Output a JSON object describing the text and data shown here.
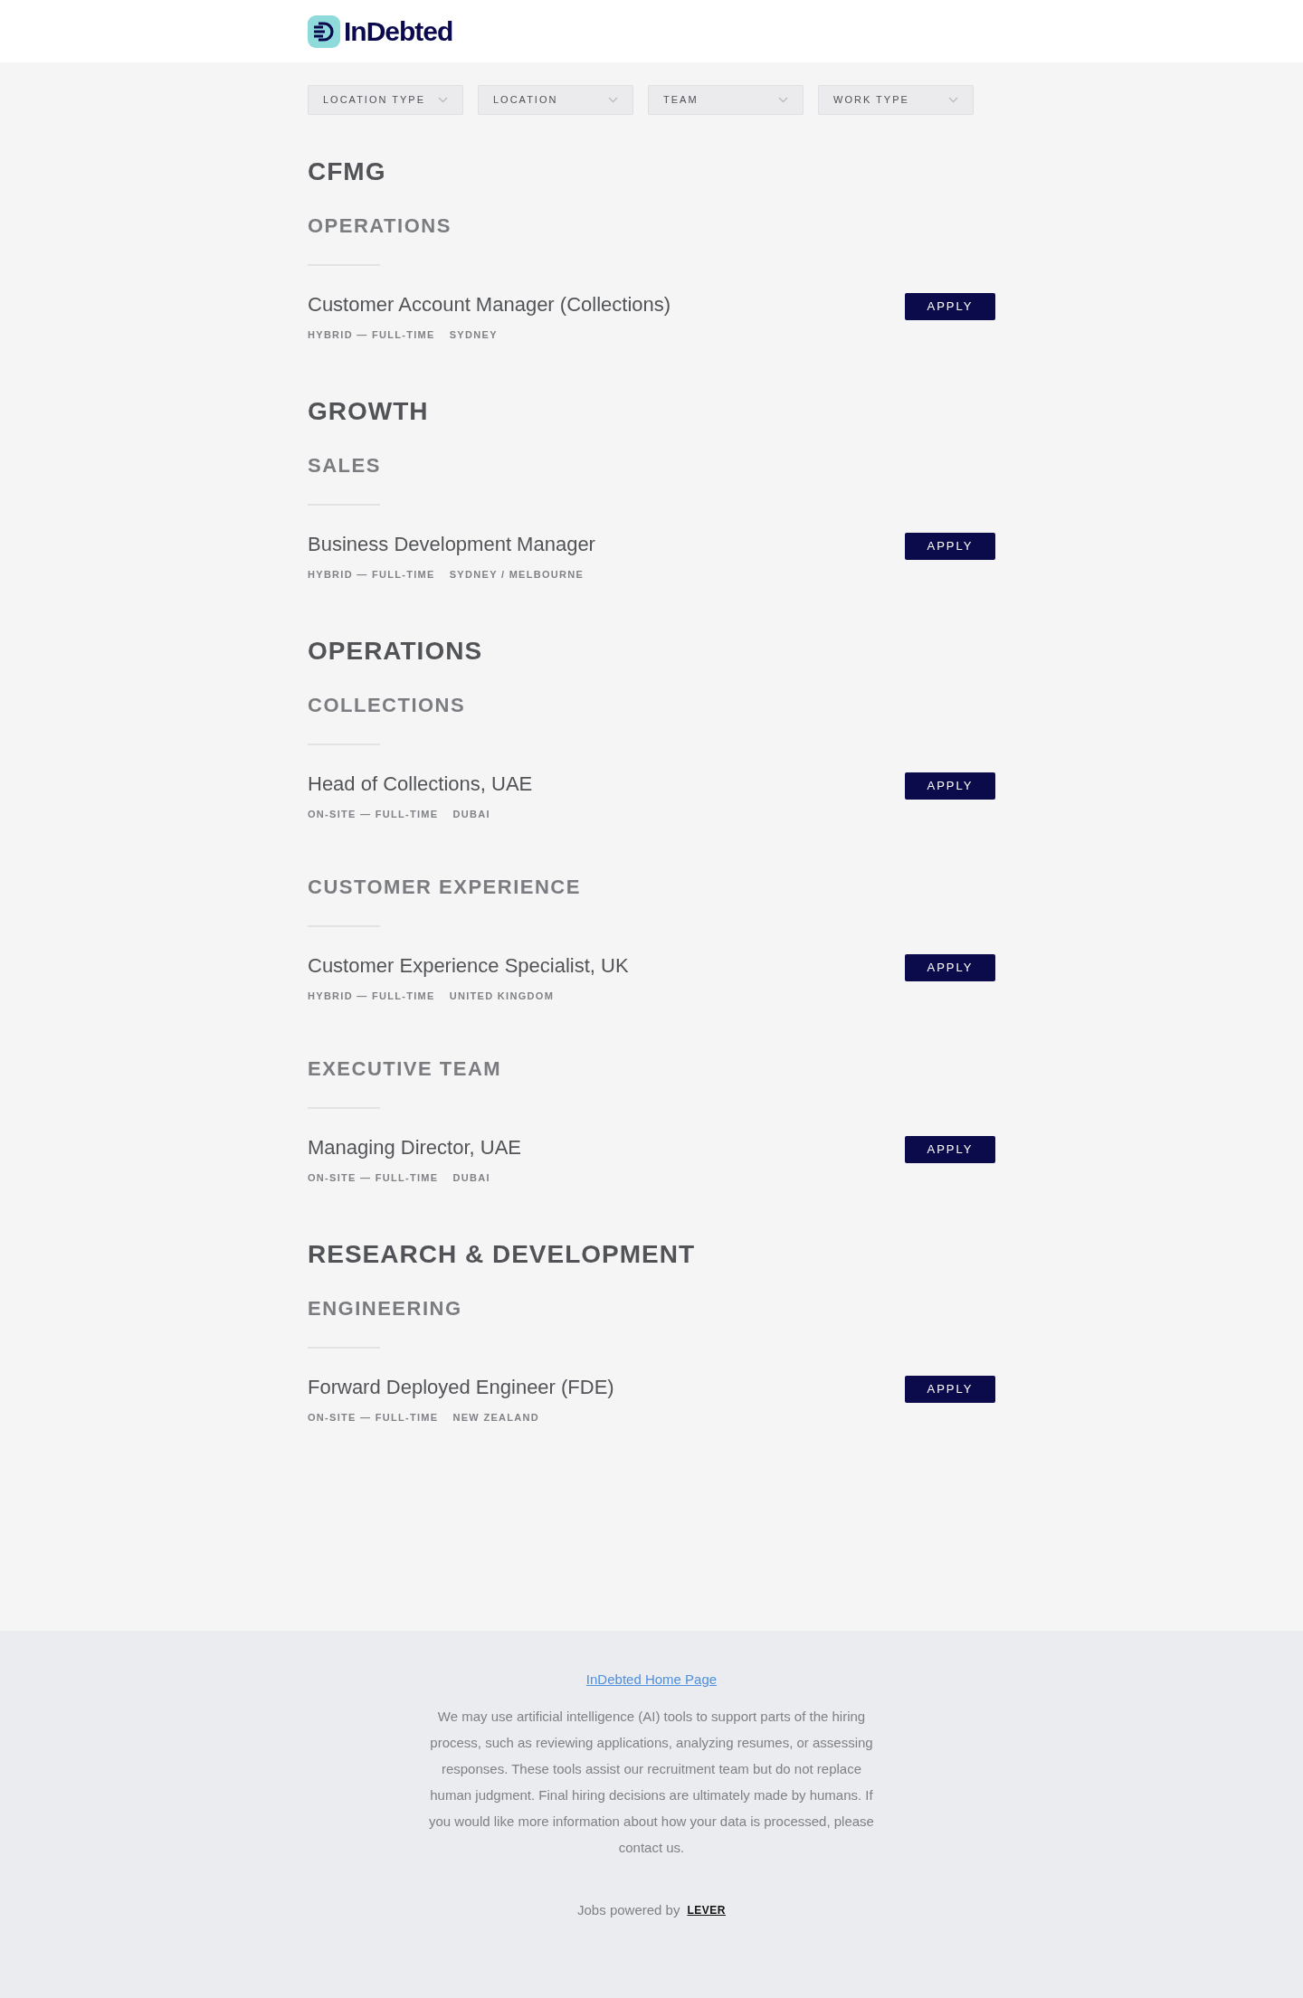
{
  "header": {
    "logo_text": "InDebted"
  },
  "filters": [
    {
      "label": "LOCATION TYPE"
    },
    {
      "label": "LOCATION"
    },
    {
      "label": "TEAM"
    },
    {
      "label": "WORK TYPE"
    }
  ],
  "departments": [
    {
      "name": "CFMG",
      "teams": [
        {
          "name": "OPERATIONS",
          "postings": [
            {
              "title": "Customer Account Manager (Collections)",
              "meta": "HYBRID — FULL-TIME",
              "location": "SYDNEY",
              "button": "APPLY"
            }
          ]
        }
      ]
    },
    {
      "name": "GROWTH",
      "teams": [
        {
          "name": "SALES",
          "postings": [
            {
              "title": "Business Development Manager",
              "meta": "HYBRID — FULL-TIME",
              "location": "SYDNEY / MELBOURNE",
              "button": "APPLY"
            }
          ]
        }
      ]
    },
    {
      "name": "OPERATIONS",
      "teams": [
        {
          "name": "COLLECTIONS",
          "postings": [
            {
              "title": "Head of Collections, UAE",
              "meta": "ON-SITE — FULL-TIME",
              "location": "DUBAI",
              "button": "APPLY"
            }
          ]
        },
        {
          "name": "CUSTOMER EXPERIENCE",
          "postings": [
            {
              "title": "Customer Experience Specialist, UK",
              "meta": "HYBRID — FULL-TIME",
              "location": "UNITED KINGDOM",
              "button": "APPLY"
            }
          ]
        },
        {
          "name": "EXECUTIVE TEAM",
          "postings": [
            {
              "title": "Managing Director, UAE",
              "meta": "ON-SITE — FULL-TIME",
              "location": "DUBAI",
              "button": "APPLY"
            }
          ]
        }
      ]
    },
    {
      "name": "RESEARCH & DEVELOPMENT",
      "teams": [
        {
          "name": "ENGINEERING",
          "postings": [
            {
              "title": "Forward Deployed Engineer (FDE)",
              "meta": "ON-SITE — FULL-TIME",
              "location": "NEW ZEALAND",
              "button": "APPLY"
            }
          ]
        }
      ]
    }
  ],
  "footer": {
    "link": "InDebted Home Page",
    "disclaimer": "We may use artificial intelligence (AI) tools to support parts of the hiring process, such as reviewing applications, analyzing resumes, or assessing responses. These tools assist our recruitment team but do not replace human judgment. Final hiring decisions are ultimately made by humans. If you would like more information about how your data is processed, please contact us.",
    "powered_by": "Jobs powered by",
    "brand": "LEVER"
  }
}
